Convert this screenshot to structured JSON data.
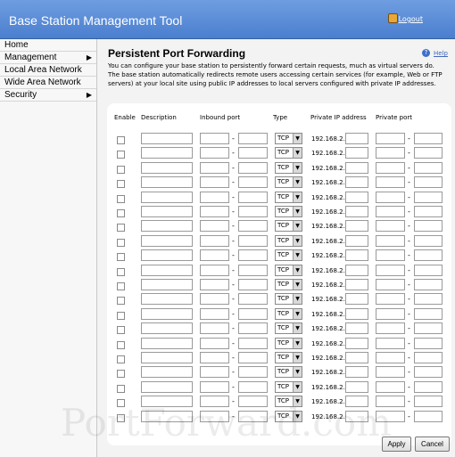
{
  "header": {
    "app_title": "Base Station Management Tool",
    "logout_label": "Logout"
  },
  "sidebar": {
    "items": [
      {
        "label": "Home",
        "has_submenu": false
      },
      {
        "label": "Management",
        "has_submenu": true
      },
      {
        "label": "Local Area Network",
        "has_submenu": false
      },
      {
        "label": "Wide Area Network",
        "has_submenu": false
      },
      {
        "label": "Security",
        "has_submenu": true
      }
    ]
  },
  "main": {
    "title": "Persistent Port Forwarding",
    "help_label": "Help",
    "intro": "You can configure your base station to persistently forward certain requests, much as virtual servers do. The base station automatically redirects remote users accessing certain services (for example, Web or FTP servers) at your local site using public IP addresses to local servers configured with private IP addresses.",
    "columns": [
      "Enable",
      "Description",
      "Inbound port",
      "Type",
      "Private IP address",
      "Private port"
    ],
    "row_count": 20,
    "row_defaults": {
      "type": "TCP",
      "ip_prefix": "192.168.2.",
      "port_sep": "-"
    }
  },
  "footer": {
    "apply_label": "Apply",
    "cancel_label": "Cancel"
  },
  "watermark": "PortForward.com",
  "colors": {
    "header_bg": "#5b8ed8",
    "sidebar_bg": "#f7f7f7",
    "content_bg": "#f3f3f3",
    "panel_bg": "#ffffff"
  }
}
